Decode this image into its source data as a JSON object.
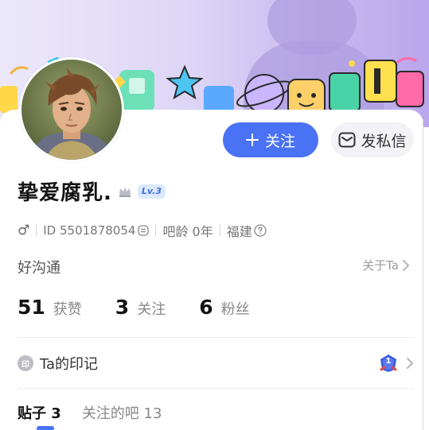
{
  "header": {
    "follow_label": "关注",
    "message_label": "发私信"
  },
  "profile": {
    "name": "挚爱腐乳.",
    "level": "Lv.3",
    "gender_symbol": "♂",
    "id_text": "ID 5501878054",
    "age_text": "吧龄 0年",
    "location": "福建",
    "tag": "好沟通",
    "about_link": "关于Ta"
  },
  "stats": [
    {
      "value": "51",
      "label": "获赞"
    },
    {
      "value": "3",
      "label": "关注"
    },
    {
      "value": "6",
      "label": "粉丝"
    }
  ],
  "imprint": {
    "icon_char": "印",
    "label": "Ta的印记",
    "badge_number": "1"
  },
  "tabs": {
    "posts_label": "贴子",
    "posts_count": "3",
    "followed_bars_label": "关注的吧",
    "followed_bars_count": "13"
  },
  "colors": {
    "accent": "#4a72f5",
    "banner_purple": "#c8b8f0"
  },
  "icons": [
    "plus-icon",
    "envelope-icon",
    "crown-icon",
    "copy-icon",
    "question-icon",
    "chevron-right-icon",
    "medal-icon"
  ]
}
